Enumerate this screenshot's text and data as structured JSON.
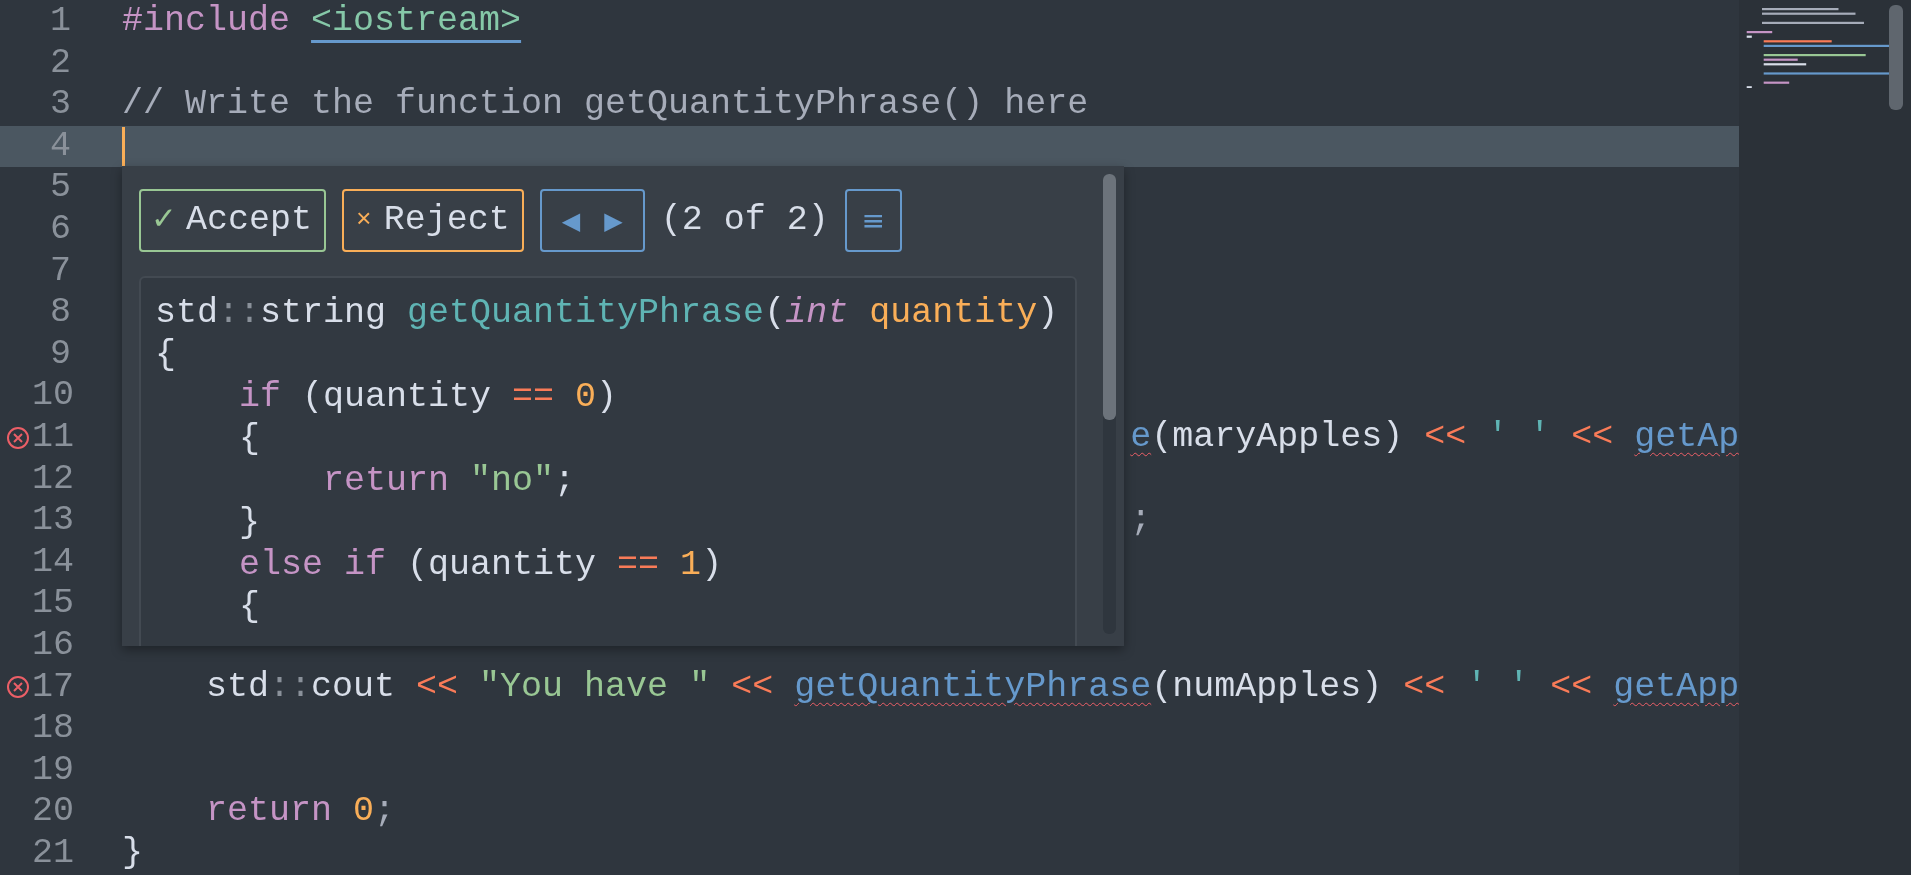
{
  "editor": {
    "lines": [
      {
        "number": "1",
        "error": false,
        "current": false,
        "tokens": [
          {
            "text": "#include ",
            "kind": "directive"
          },
          {
            "text": "<iostream>",
            "kind": "include-link"
          }
        ]
      },
      {
        "number": "2",
        "error": false,
        "current": false
      },
      {
        "number": "3",
        "error": false,
        "current": false,
        "tokens": [
          {
            "text": "// Write the function getQuantityPhrase() here",
            "kind": "comment"
          }
        ]
      },
      {
        "number": "4",
        "error": false,
        "current": true
      },
      {
        "number": "5",
        "error": false,
        "current": false
      },
      {
        "number": "6",
        "error": false,
        "current": false
      },
      {
        "number": "7",
        "error": false,
        "current": false
      },
      {
        "number": "8",
        "error": false,
        "current": false
      },
      {
        "number": "9",
        "error": false,
        "current": false
      },
      {
        "number": "10",
        "error": false,
        "current": false
      },
      {
        "number": "11",
        "error": true,
        "current": false,
        "tokens": [
          {
            "text": "                                                e",
            "kind": "unresolved"
          },
          {
            "text": "(maryApples) ",
            "kind": "plain"
          },
          {
            "text": "<< ",
            "kind": "operator"
          },
          {
            "text": "' ' ",
            "kind": "char"
          },
          {
            "text": "<< ",
            "kind": "operator"
          },
          {
            "text": "getAp",
            "kind": "unresolved"
          }
        ]
      },
      {
        "number": "12",
        "error": false,
        "current": false
      },
      {
        "number": "13",
        "error": false,
        "current": false,
        "tokens": [
          {
            "text": "                                                ;",
            "kind": "punct"
          }
        ]
      },
      {
        "number": "14",
        "error": false,
        "current": false
      },
      {
        "number": "15",
        "error": false,
        "current": false
      },
      {
        "number": "16",
        "error": false,
        "current": false
      },
      {
        "number": "17",
        "error": true,
        "current": false,
        "tokens": [
          {
            "text": "    std",
            "kind": "plain"
          },
          {
            "text": "::",
            "kind": "scope"
          },
          {
            "text": "cout ",
            "kind": "plain"
          },
          {
            "text": "<< ",
            "kind": "operator"
          },
          {
            "text": "\"You have \" ",
            "kind": "string"
          },
          {
            "text": "<< ",
            "kind": "operator"
          },
          {
            "text": "getQuantityPhrase",
            "kind": "unresolved"
          },
          {
            "text": "(numApples) ",
            "kind": "plain"
          },
          {
            "text": "<< ",
            "kind": "operator"
          },
          {
            "text": "' ' ",
            "kind": "char"
          },
          {
            "text": "<< ",
            "kind": "operator"
          },
          {
            "text": "getApp",
            "kind": "unresolved"
          }
        ]
      },
      {
        "number": "18",
        "error": false,
        "current": false
      },
      {
        "number": "19",
        "error": false,
        "current": false
      },
      {
        "number": "20",
        "error": false,
        "current": false,
        "tokens": [
          {
            "text": "    return ",
            "kind": "keyword"
          },
          {
            "text": "0",
            "kind": "number"
          },
          {
            "text": ";",
            "kind": "punct"
          }
        ]
      },
      {
        "number": "21",
        "error": false,
        "current": false,
        "tokens": [
          {
            "text": "}",
            "kind": "plain"
          }
        ]
      }
    ]
  },
  "suggestion_popup": {
    "buttons": [
      {
        "kind": "accept",
        "icon": "✓",
        "label": "Accept"
      },
      {
        "kind": "reject",
        "icon": "×",
        "label": "Reject"
      }
    ],
    "nav": {
      "previous": "◀",
      "next": "▶"
    },
    "counter": "(2 of 2)",
    "menu": "≡",
    "code_lines": [
      {
        "tokens": [
          {
            "text": "std",
            "kind": "plain"
          },
          {
            "text": "::",
            "kind": "scope"
          },
          {
            "text": "string ",
            "kind": "plain"
          },
          {
            "text": "getQuantityPhrase",
            "kind": "definition"
          },
          {
            "text": "(",
            "kind": "plain"
          },
          {
            "text": "int ",
            "kind": "type"
          },
          {
            "text": "quantity",
            "kind": "param"
          },
          {
            "text": ")",
            "kind": "plain"
          }
        ]
      },
      {
        "tokens": [
          {
            "text": "{",
            "kind": "plain"
          }
        ]
      },
      {
        "tokens": [
          {
            "text": "    if ",
            "kind": "keyword"
          },
          {
            "text": "(quantity ",
            "kind": "plain"
          },
          {
            "text": "== ",
            "kind": "operator"
          },
          {
            "text": "0",
            "kind": "number"
          },
          {
            "text": ")",
            "kind": "plain"
          }
        ]
      },
      {
        "tokens": [
          {
            "text": "    {",
            "kind": "plain"
          }
        ]
      },
      {
        "tokens": [
          {
            "text": "        return ",
            "kind": "keyword"
          },
          {
            "text": "\"no\"",
            "kind": "string"
          },
          {
            "text": ";",
            "kind": "plain"
          }
        ]
      },
      {
        "tokens": [
          {
            "text": "    }",
            "kind": "plain"
          }
        ]
      },
      {
        "tokens": [
          {
            "text": "    else if ",
            "kind": "keyword"
          },
          {
            "text": "(quantity ",
            "kind": "plain"
          },
          {
            "text": "== ",
            "kind": "operator"
          },
          {
            "text": "1",
            "kind": "number"
          },
          {
            "text": ")",
            "kind": "plain"
          }
        ]
      },
      {
        "tokens": [
          {
            "text": "    {",
            "kind": "plain"
          }
        ]
      }
    ]
  }
}
